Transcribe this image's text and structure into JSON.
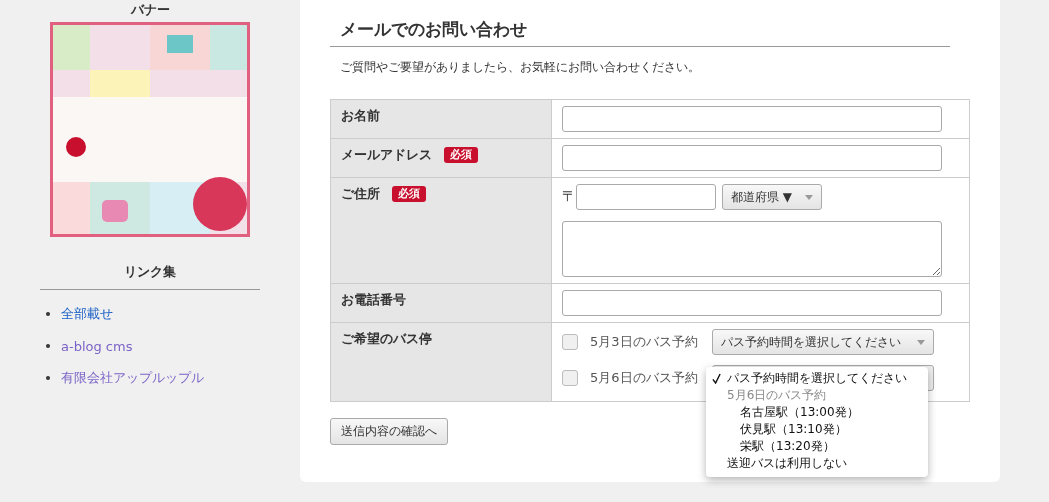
{
  "sidebar": {
    "banner_heading": "バナー",
    "links_heading": "リンク集",
    "links": [
      {
        "label": "全部載せ",
        "visited": false
      },
      {
        "label": "a-blog cms",
        "visited": true
      },
      {
        "label": "有限会社アップルップル",
        "visited": true
      }
    ]
  },
  "main": {
    "title": "メールでのお問い合わせ",
    "intro": "ご質問やご要望がありましたら、お気軽にお問い合わせください。",
    "rows": [
      {
        "kind": "text",
        "label": "お名前",
        "required": false
      },
      {
        "kind": "text",
        "label": "メールアドレス",
        "required": true,
        "badge": "必須"
      },
      {
        "kind": "address",
        "label": "ご住所",
        "required": true,
        "badge": "必須",
        "zip_mark": "〒",
        "prefecture": "都道府県 ▼"
      },
      {
        "kind": "text",
        "label": "お電話番号",
        "required": false
      },
      {
        "kind": "bus",
        "label": "ご希望のバス停",
        "required": false,
        "options": [
          {
            "label": "5月3日のバス予約",
            "checked": false,
            "select": "パス予約時間を選択してください"
          },
          {
            "label": "5月6日のバス予約",
            "checked": false
          }
        ]
      }
    ],
    "submit": "送信内容の確認へ",
    "dropdown": {
      "items": [
        {
          "kind": "option",
          "label": "パス予約時間を選択してください",
          "selected": true
        },
        {
          "kind": "group",
          "label": "5月6日のバス予約"
        },
        {
          "kind": "suboption",
          "label": "名古屋駅（13:00発）",
          "selected": false
        },
        {
          "kind": "suboption",
          "label": "伏見駅（13:10発）",
          "selected": false
        },
        {
          "kind": "suboption",
          "label": "栄駅（13:20発）",
          "selected": false
        },
        {
          "kind": "option",
          "label": "送迎バスは利用しない",
          "selected": false
        }
      ]
    }
  }
}
